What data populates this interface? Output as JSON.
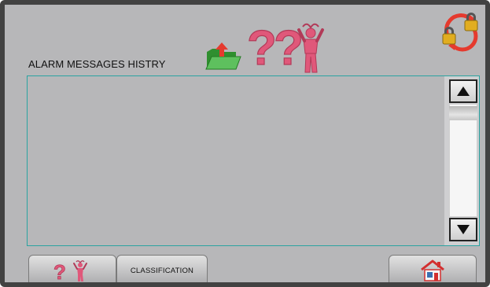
{
  "header": {
    "title": "ALARM MESSAGES HISTRY",
    "icons": [
      "export-folder-icon",
      "help-person-icon",
      "lock-rotate-icon"
    ]
  },
  "list": {
    "items": []
  },
  "scrollbar": {
    "up_icon": "triangle-up-icon",
    "down_icon": "triangle-down-icon"
  },
  "footer": {
    "help_icon": "help-person-icon",
    "classification_label": "CLASSIFICATION",
    "home_icon": "home-icon"
  },
  "colors": {
    "panel": "#b7b7b9",
    "list_border": "#2aa3a1",
    "accent_pink": "#e0587a",
    "folder_green": "#3aa53a"
  }
}
